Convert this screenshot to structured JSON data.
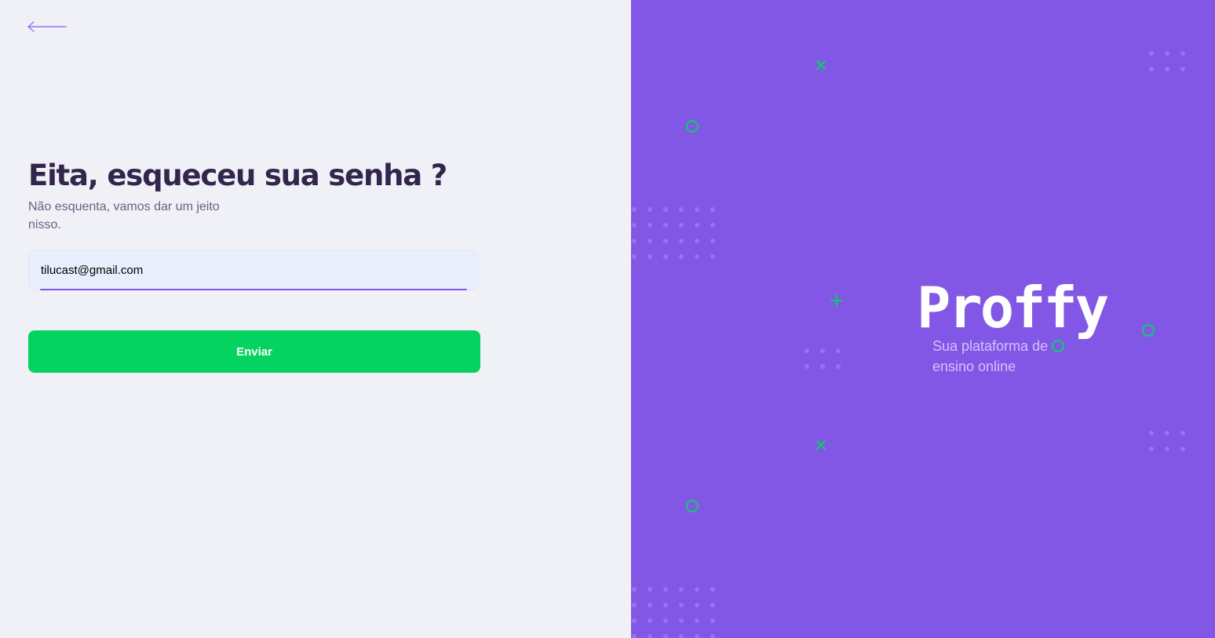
{
  "colors": {
    "left_background": "#F0F0F7",
    "right_background": "#8257E5",
    "title": "#32264D",
    "subtitle": "#6A6180",
    "input_background": "#E8EEFB",
    "input_underline": "#8257E5",
    "button": "#04D361",
    "button_text": "#FFFFFF",
    "logo": "#FFFFFF",
    "tagline": "#D4C2FF",
    "decoration_accent": "#04D361",
    "decoration_dots": "#9871F5"
  },
  "navigation": {
    "back_icon": "arrow-left-icon"
  },
  "form": {
    "title": "Eita, esqueceu sua senha ?",
    "subtitle": "Não esquenta, vamos dar um jeito nisso.",
    "email_value": "tilucast@gmail.com",
    "submit_label": "Enviar"
  },
  "brand": {
    "logo_text": "Proffy",
    "tagline": "Sua plataforma de ensino online"
  },
  "decoration": {
    "icons": [
      "close-icon",
      "circle-icon",
      "plus-icon",
      "dot-grid"
    ]
  }
}
